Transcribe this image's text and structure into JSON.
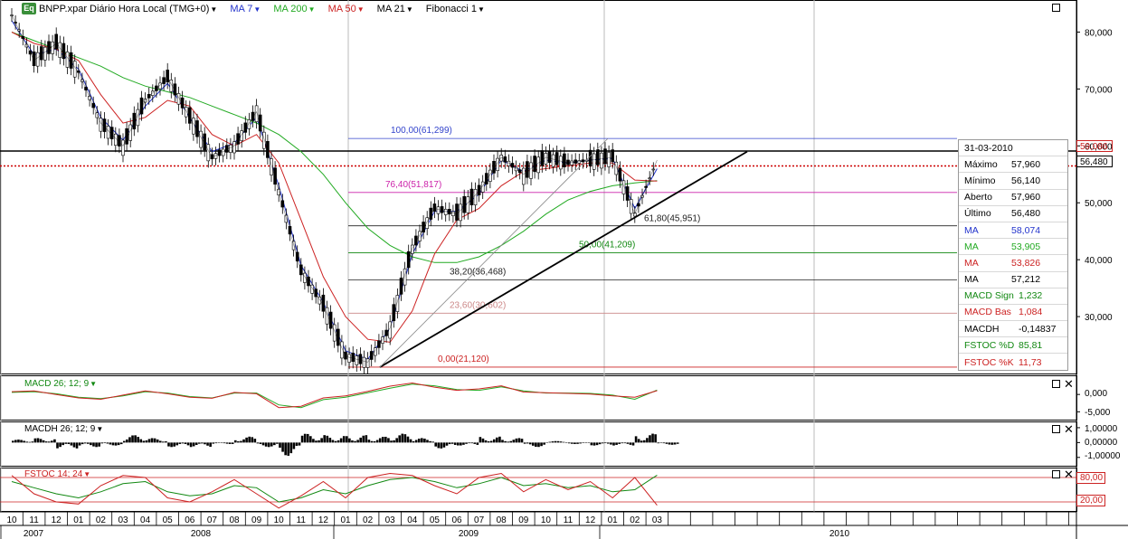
{
  "toolbar": {
    "logo": "Eq",
    "symbol": "BNPP.xpar Diário Hora Local (TMG+0)",
    "indicators": [
      {
        "label": "MA 7",
        "color": "#2233cc"
      },
      {
        "label": "MA 200",
        "color": "#22aa22"
      },
      {
        "label": "MA 50",
        "color": "#cc2222"
      },
      {
        "label": "MA 21",
        "color": "#000000"
      },
      {
        "label": "Fibonacci 1",
        "color": "#000000"
      }
    ]
  },
  "info_box": {
    "date": "31-03-2010",
    "rows": [
      {
        "key": "Máximo",
        "value": "57,960",
        "color": "#000000"
      },
      {
        "key": "Mínimo",
        "value": "56,140",
        "color": "#000000"
      },
      {
        "key": "Aberto",
        "value": "57,960",
        "color": "#000000"
      },
      {
        "key": "Último",
        "value": "56,480",
        "color": "#000000"
      },
      {
        "key": "MA",
        "value": "58,074",
        "color": "#2233cc"
      },
      {
        "key": "MA",
        "value": "53,905",
        "color": "#22aa22"
      },
      {
        "key": "MA",
        "value": "53,826",
        "color": "#cc2222"
      },
      {
        "key": "MA",
        "value": "57,212",
        "color": "#000000"
      },
      {
        "key": "MACD Sign",
        "value": "1,232",
        "color": "#118811"
      },
      {
        "key": "MACD Bas",
        "value": "1,084",
        "color": "#cc2222"
      },
      {
        "key": "MACDH",
        "value": "-0,14837",
        "color": "#000000"
      },
      {
        "key": "FSTOC %D",
        "value": "85,81",
        "color": "#118811"
      },
      {
        "key": "FSTOC %K",
        "value": "11,73",
        "color": "#cc2222"
      }
    ]
  },
  "price_tags": {
    "line": {
      "value": "59,086",
      "color": "#cc2222"
    },
    "last": {
      "value": "56,480",
      "color": "#000000"
    }
  },
  "panels": {
    "macd": {
      "label": "MACD 26; 12; 9",
      "color": "#118811",
      "ticks": [
        "0,000",
        "-5,000"
      ]
    },
    "macdh": {
      "label": "MACDH 26; 12; 9",
      "color": "#000000",
      "ticks": [
        "1,00000",
        "0,00000",
        "-1,00000"
      ]
    },
    "fstoc": {
      "label": "FSTOC 14; 24",
      "color": "#cc2222",
      "ticks": [
        "80,00",
        "20,00"
      ]
    }
  },
  "chart_data": {
    "type": "line",
    "title": "BNPP.xpar Diário Hora Local (TMG+0)",
    "x": [
      "2007-10",
      "2007-11",
      "2007-12",
      "2008-01",
      "2008-02",
      "2008-03",
      "2008-04",
      "2008-05",
      "2008-06",
      "2008-07",
      "2008-08",
      "2008-09",
      "2008-10",
      "2008-11",
      "2008-12",
      "2009-01",
      "2009-02",
      "2009-03",
      "2009-04",
      "2009-05",
      "2009-06",
      "2009-07",
      "2009-08",
      "2009-09",
      "2009-10",
      "2009-11",
      "2009-12",
      "2010-01",
      "2010-02",
      "2010-03"
    ],
    "y_ticks": [
      "30,000",
      "40,000",
      "50,000",
      "60,000",
      "70,000",
      "80,000"
    ],
    "ylim": [
      20000,
      85000
    ],
    "month_labels": [
      "10",
      "11",
      "12",
      "01",
      "02",
      "03",
      "04",
      "05",
      "06",
      "07",
      "08",
      "09",
      "10",
      "11",
      "12",
      "01",
      "02",
      "03",
      "04",
      "05",
      "06",
      "07",
      "08",
      "09",
      "10",
      "11",
      "12",
      "01",
      "02",
      "03"
    ],
    "year_labels": [
      "2007",
      "2008",
      "2009",
      "2010"
    ],
    "series": [
      {
        "name": "BNPP.xpar",
        "color": "#000000",
        "values": [
          83000,
          75000,
          78000,
          73000,
          64000,
          60000,
          68000,
          72000,
          65000,
          58000,
          60000,
          66000,
          52000,
          38000,
          32000,
          23000,
          22000,
          28000,
          42000,
          49000,
          48000,
          52000,
          58000,
          55000,
          58000,
          57000,
          57500,
          58000,
          48000,
          57500
        ]
      },
      {
        "name": "MA 7",
        "color": "#2233cc",
        "values": [
          82000,
          76000,
          77000,
          73500,
          65000,
          61000,
          67000,
          71000,
          65000,
          59000,
          60500,
          65000,
          53000,
          39000,
          32500,
          24000,
          22500,
          28000,
          41000,
          48500,
          48500,
          51500,
          57500,
          55500,
          57500,
          57000,
          57500,
          57800,
          49000,
          56000
        ]
      },
      {
        "name": "MA 200",
        "color": "#22aa22",
        "values": [
          80000,
          78500,
          77000,
          75500,
          74000,
          72000,
          70500,
          69500,
          68500,
          67000,
          65500,
          64000,
          62000,
          59000,
          55000,
          50000,
          45500,
          42500,
          40500,
          39500,
          39500,
          40500,
          42500,
          45000,
          48000,
          50500,
          52000,
          53000,
          53500,
          53905
        ]
      },
      {
        "name": "MA 50",
        "color": "#cc2222",
        "values": [
          80000,
          78000,
          77000,
          75000,
          69000,
          64000,
          65000,
          68000,
          67000,
          62000,
          60000,
          62000,
          57000,
          47000,
          37000,
          30000,
          26000,
          25500,
          31000,
          41000,
          47000,
          49000,
          53000,
          55500,
          56000,
          56500,
          57000,
          57000,
          54000,
          53826
        ]
      }
    ],
    "fibonacci": [
      {
        "label": "100,00(61,299)",
        "value": 61299,
        "color": "#3344cc"
      },
      {
        "label": "76,40(51,817)",
        "value": 51817,
        "color": "#cc22aa"
      },
      {
        "label": "61,80(45,951)",
        "value": 45951,
        "color": "#222222"
      },
      {
        "label": "50,00(41,209)",
        "value": 41209,
        "color": "#118811"
      },
      {
        "label": "38,20(36,468)",
        "value": 36468,
        "color": "#222222"
      },
      {
        "label": "23,60(30,602)",
        "value": 30602,
        "color": "#cc8888"
      },
      {
        "label": "0,00(21,120)",
        "value": 21120,
        "color": "#cc2222"
      }
    ],
    "hlines": [
      {
        "value": 59086,
        "style": "solid",
        "color": "#000000"
      },
      {
        "value": 56480,
        "style": "dotted",
        "color": "#cc0000"
      }
    ],
    "trendline": {
      "from": [
        "2009-03",
        21120
      ],
      "to": [
        "2010-06",
        58000
      ]
    },
    "macd": {
      "range": [
        -7,
        5
      ],
      "signal": [
        0.6,
        0.8,
        0.2,
        -0.8,
        -1.2,
        -0.4,
        0.8,
        0.4,
        -0.6,
        -1.0,
        0.4,
        0.4,
        -3.0,
        -3.8,
        -1.5,
        -0.8,
        0.5,
        1.8,
        3.0,
        2.5,
        1.4,
        1.2,
        2.2,
        1.0,
        0.4,
        0.4,
        0.3,
        -0.2,
        -1.4,
        1.232
      ],
      "base": [
        0.8,
        1.0,
        0.0,
        -1.0,
        -1.4,
        -0.2,
        1.0,
        0.2,
        -0.8,
        -1.1,
        0.6,
        0.2,
        -3.8,
        -3.4,
        -1.0,
        -0.4,
        0.9,
        2.4,
        3.3,
        2.1,
        1.2,
        1.6,
        2.5,
        0.7,
        0.5,
        0.3,
        0.1,
        -0.4,
        -0.8,
        1.084
      ]
    },
    "macdh": {
      "range": [
        -1.5,
        1.3
      ],
      "values": [
        0.2,
        0.3,
        -0.4,
        -0.3,
        -0.2,
        0.5,
        0.3,
        -0.3,
        -0.3,
        -0.1,
        0.4,
        -0.3,
        -0.9,
        0.6,
        0.5,
        0.5,
        0.4,
        0.6,
        0.3,
        -0.4,
        -0.2,
        0.4,
        0.3,
        -0.3,
        0.1,
        -0.1,
        -0.2,
        -0.2,
        0.6,
        -0.14837
      ]
    },
    "fstoc": {
      "range": [
        0,
        100
      ],
      "d": [
        70,
        55,
        40,
        30,
        45,
        65,
        70,
        45,
        35,
        40,
        60,
        55,
        20,
        30,
        50,
        40,
        60,
        75,
        80,
        70,
        55,
        65,
        80,
        60,
        65,
        55,
        60,
        45,
        50,
        85.81
      ],
      "k": [
        85,
        40,
        20,
        15,
        60,
        85,
        80,
        30,
        20,
        45,
        75,
        40,
        5,
        35,
        70,
        30,
        80,
        90,
        85,
        60,
        40,
        80,
        90,
        45,
        75,
        50,
        70,
        30,
        80,
        11.73
      ]
    }
  }
}
